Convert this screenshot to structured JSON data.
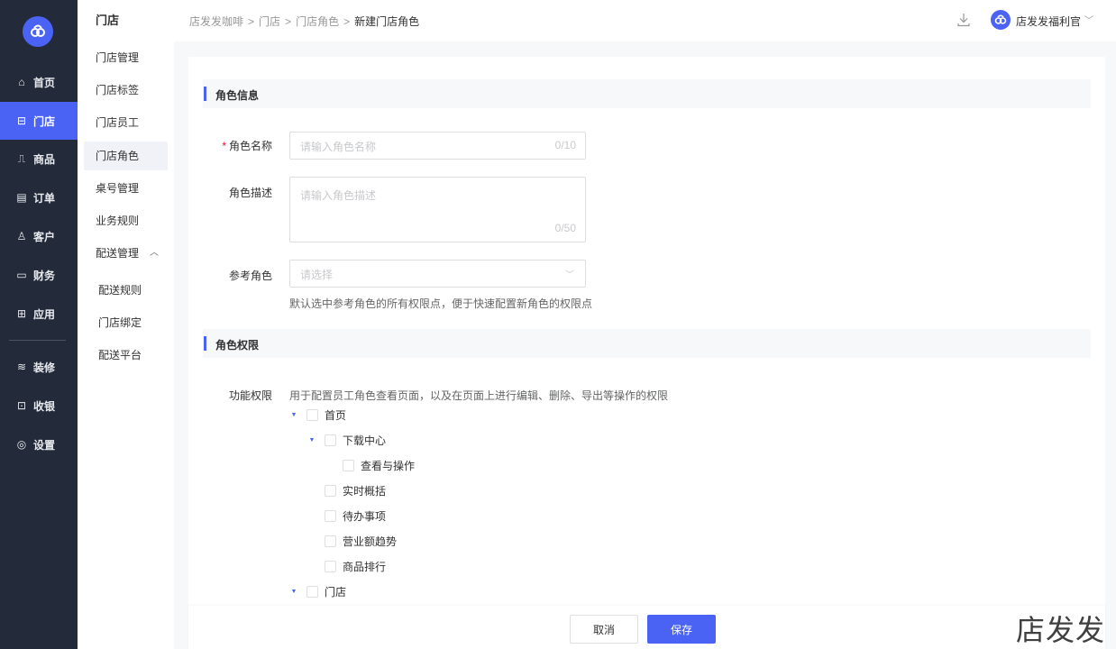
{
  "nav": {
    "items": [
      {
        "icon": "home-icon",
        "glyph": "⌂",
        "label": "首页"
      },
      {
        "icon": "store-icon",
        "glyph": "⊟",
        "label": "门店"
      },
      {
        "icon": "bag-icon",
        "glyph": "⎍",
        "label": "商品"
      },
      {
        "icon": "order-icon",
        "glyph": "▤",
        "label": "订单"
      },
      {
        "icon": "user-icon",
        "glyph": "♙",
        "label": "客户"
      },
      {
        "icon": "wallet-icon",
        "glyph": "▭",
        "label": "财务"
      },
      {
        "icon": "apps-icon",
        "glyph": "⊞",
        "label": "应用"
      },
      {
        "icon": "layers-icon",
        "glyph": "≋",
        "label": "装修"
      },
      {
        "icon": "cashier-icon",
        "glyph": "⊡",
        "label": "收银"
      },
      {
        "icon": "settings-icon",
        "glyph": "◎",
        "label": "设置"
      }
    ],
    "active_index": 1,
    "accent": "#4a63f5"
  },
  "submenu": {
    "title": "门店",
    "items": [
      "门店管理",
      "门店标签",
      "门店员工",
      "门店角色",
      "桌号管理",
      "业务规则",
      "配送管理"
    ],
    "active": "门店角色",
    "children": [
      "配送规则",
      "门店绑定",
      "配送平台"
    ]
  },
  "breadcrumb": [
    "店发发咖啡",
    "门店",
    "门店角色",
    "新建门店角色"
  ],
  "user": {
    "name": "店发发福利官"
  },
  "sections": {
    "info": "角色信息",
    "perm": "角色权限"
  },
  "form": {
    "name_label": "角色名称",
    "name_placeholder": "请输入角色名称",
    "name_count": "0/10",
    "desc_label": "角色描述",
    "desc_placeholder": "请输入角色描述",
    "desc_count": "0/50",
    "ref_label": "参考角色",
    "ref_placeholder": "请选择",
    "ref_help": "默认选中参考角色的所有权限点，便于快速配置新角色的权限点",
    "func_label": "功能权限",
    "func_help": "用于配置员工角色查看页面，以及在页面上进行编辑、删除、导出等操作的权限"
  },
  "tree": [
    {
      "label": "首页",
      "expandable": true
    },
    {
      "label": "下载中心",
      "expandable": true
    },
    {
      "label": "查看与操作",
      "expandable": false
    },
    {
      "label": "实时概括",
      "expandable": false
    },
    {
      "label": "待办事项",
      "expandable": false
    },
    {
      "label": "营业额趋势",
      "expandable": false
    },
    {
      "label": "商品排行",
      "expandable": false
    },
    {
      "label": "门店",
      "expandable": true
    }
  ],
  "footer": {
    "cancel": "取消",
    "save": "保存"
  },
  "watermark": "店发发"
}
